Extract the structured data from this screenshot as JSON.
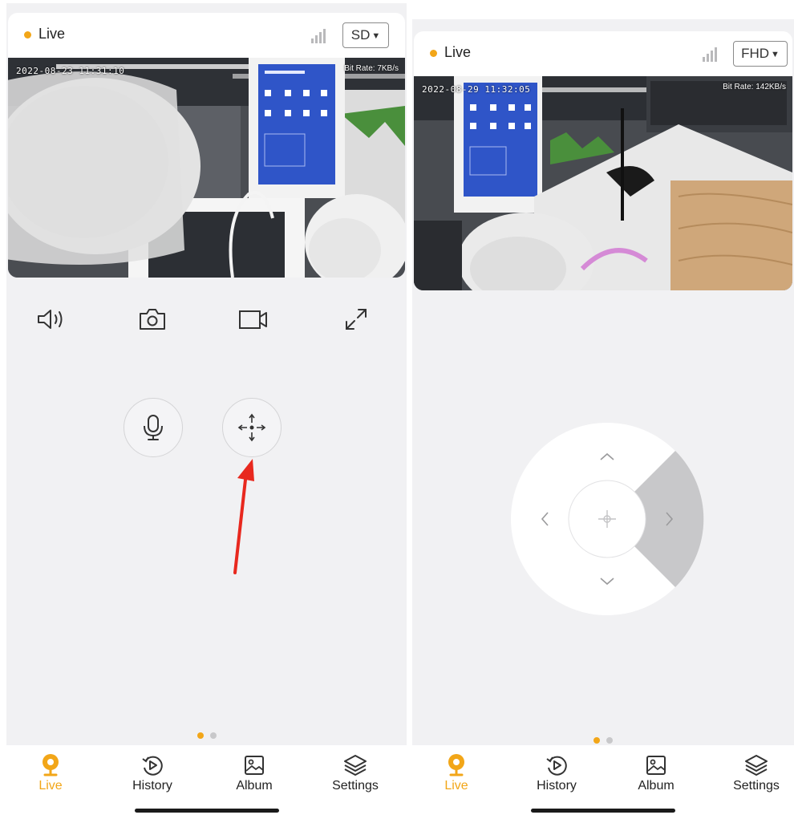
{
  "left_screen": {
    "status": {
      "label": "Live",
      "quality": "SD"
    },
    "video": {
      "timestamp": "2022-08-23 11:31:10",
      "bitrate": "Bit Rate: 7KB/s"
    },
    "controls": [
      "speaker-icon",
      "camera-icon",
      "video-record-icon",
      "fullscreen-icon"
    ],
    "actions": [
      "microphone-icon",
      "ptz-move-icon"
    ],
    "page_dots": {
      "count": 2,
      "active": 0
    }
  },
  "right_screen": {
    "status": {
      "label": "Live",
      "quality": "FHD"
    },
    "video": {
      "timestamp": "2022-08-29 11:32:05",
      "bitrate": "Bit Rate: 142KB/s"
    },
    "ptz_pad": {
      "directions": [
        "up",
        "down",
        "left",
        "right"
      ],
      "pressed": "right"
    },
    "page_dots": {
      "count": 2,
      "active": 0
    }
  },
  "tabbar": {
    "items": [
      {
        "label": "Live",
        "icon": "live-camera-icon",
        "active": true
      },
      {
        "label": "History",
        "icon": "history-playback-icon",
        "active": false
      },
      {
        "label": "Album",
        "icon": "album-image-icon",
        "active": false
      },
      {
        "label": "Settings",
        "icon": "settings-layers-icon",
        "active": false
      }
    ]
  },
  "colors": {
    "accent": "#f2a618",
    "background": "#f1f1f3",
    "arrow": "#e8281e",
    "ptz_pressed": "#c8c8ca"
  }
}
